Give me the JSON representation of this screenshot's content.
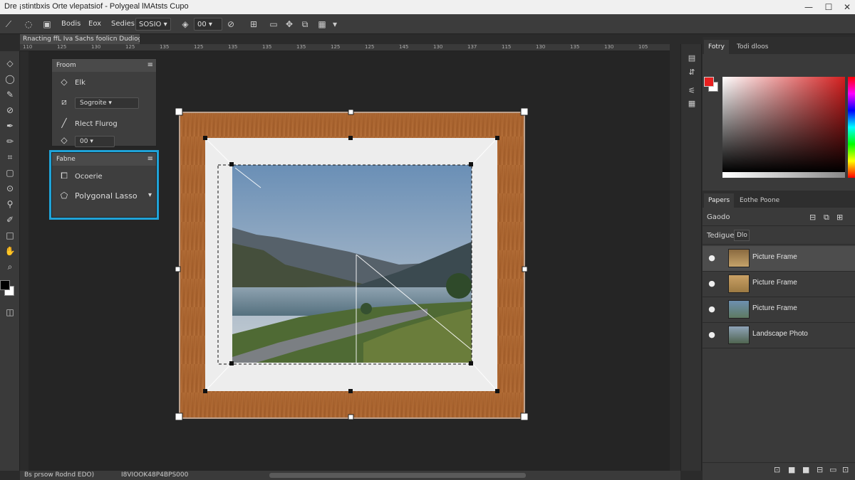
{
  "app": {
    "title": "Dre ¡stintbxis Orte vlepatsiof - Polygeal lMAtsts Cupo"
  },
  "window_buttons": {
    "minimize": "—",
    "maximize": "☐",
    "close": "✕"
  },
  "options_bar": {
    "field1": "Bodis",
    "field2": "Eox",
    "field3_label": "Sedies",
    "field3_value": "SOSIO",
    "field4_value": "00"
  },
  "document_tab": "Rnacting ffL Iva Sachs foolicn Dudiog Mnets",
  "ruler": {
    "ticks": [
      "110",
      "125",
      "130",
      "125",
      "135",
      "125",
      "135",
      "135",
      "135",
      "125",
      "125",
      "145",
      "130",
      "137",
      "115",
      "130",
      "135",
      "130",
      "105"
    ]
  },
  "panel_one": {
    "title": "Froom",
    "row1": "Elk",
    "row2_value": "Sogroite",
    "row3": "Rlect Flurog",
    "row4_value": "00"
  },
  "panel_two": {
    "title": "Fabne",
    "row1": "Ocoerie",
    "row2": "Polygonal Lasso"
  },
  "color_panel": {
    "tabs": [
      "Fotry",
      "Todi dloos"
    ],
    "fg": "#e82020",
    "bg": "#ffffff"
  },
  "layers_panel": {
    "tabs": [
      "Papers",
      "Eothe Poone"
    ],
    "blend_label": "Gaodo",
    "opacity_label": "Tedigue",
    "opacity_value": "Dlo",
    "layers": [
      {
        "name": "Picture Frame",
        "selected": true
      },
      {
        "name": "Picture Frame",
        "selected": false
      },
      {
        "name": "Picture Frame",
        "selected": false
      },
      {
        "name": "Landscape Photo",
        "selected": false
      }
    ]
  },
  "status_bar": {
    "zoom": "Bs prsow Rodnd EDO)",
    "info": "I8VIOOK48P4BPS000"
  },
  "colors": {
    "frame_wood": "#b06a35",
    "highlight_box": "#1fa3d8"
  }
}
